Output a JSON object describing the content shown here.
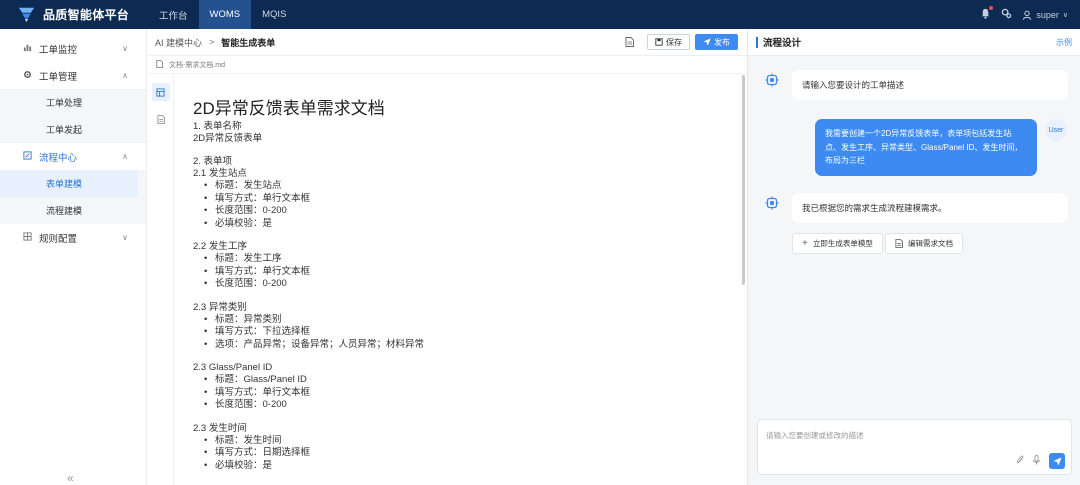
{
  "app": {
    "title": "品质智能体平台"
  },
  "topnav": [
    {
      "label": "工作台",
      "active": false
    },
    {
      "label": "WOMS",
      "active": true
    },
    {
      "label": "MQIS",
      "active": false
    }
  ],
  "user": {
    "name": "super"
  },
  "sidebar": {
    "groups": [
      {
        "label": "工单监控",
        "icon": "chart-icon",
        "expanded": false,
        "items": []
      },
      {
        "label": "工单管理",
        "icon": "gear-icon",
        "expanded": true,
        "items": [
          {
            "label": "工单处理"
          },
          {
            "label": "工单发起"
          }
        ]
      },
      {
        "label": "流程中心",
        "icon": "edit-icon",
        "expanded": true,
        "items": [
          {
            "label": "表单建模",
            "active": true
          },
          {
            "label": "流程建模"
          }
        ]
      },
      {
        "label": "规则配置",
        "icon": "grid-icon",
        "expanded": false,
        "items": []
      }
    ],
    "collapse_glyph": "«"
  },
  "breadcrumb": {
    "root": "AI 建模中心",
    "separator": ">",
    "current": "智能生成表单"
  },
  "toolbar": {
    "save_label": "保存",
    "publish_label": "发布"
  },
  "file": {
    "name": "文档-需求文档.md"
  },
  "document": {
    "title": "2D异常反馈表单需求文档",
    "s1_heading": "1. 表单名称",
    "s1_value": "2D异常反馈表单",
    "s2_heading": "2. 表单项",
    "sections": [
      {
        "heading": "2.1 发生站点",
        "bullets": [
          "标题：发生站点",
          "填写方式：单行文本框",
          "长度范围：0-200",
          "必填校验：是"
        ]
      },
      {
        "heading": "2.2 发生工序",
        "bullets": [
          "标题：发生工序",
          "填写方式：单行文本框",
          "长度范围：0-200"
        ]
      },
      {
        "heading": "2.3 异常类别",
        "bullets": [
          "标题：异常类别",
          "填写方式：下拉选择框",
          "选项：产品异常；设备异常；人员异常；材料异常"
        ]
      },
      {
        "heading": "2.3 Glass/Panel ID",
        "bullets": [
          "标题：Glass/Panel ID",
          "填写方式：单行文本框",
          "长度范围：0-200"
        ]
      },
      {
        "heading": "2.3 发生时间",
        "bullets": [
          "标题：发生时间",
          "填写方式：日期选择框",
          "必填校验：是"
        ]
      }
    ]
  },
  "panel": {
    "title": "流程设计",
    "example_link": "示例",
    "bot_prompt": "请输入您要设计的工单描述",
    "user_label": "User",
    "user_message": "我需要创建一个2D异常反馈表单，表单项包括发生站点、发生工序、异常类型、Glass/Panel ID、发生时间，布局为三栏",
    "bot_reply": "我已根据您的需求生成流程建模需求。",
    "action_generate": "立即生成表单模型",
    "action_edit": "编辑需求文档",
    "input_placeholder": "请输入您要创建或修改的描述"
  },
  "colors": {
    "topbar": "#0d2a52",
    "accent": "#3d8bf2",
    "active_tab": "#24528e"
  }
}
